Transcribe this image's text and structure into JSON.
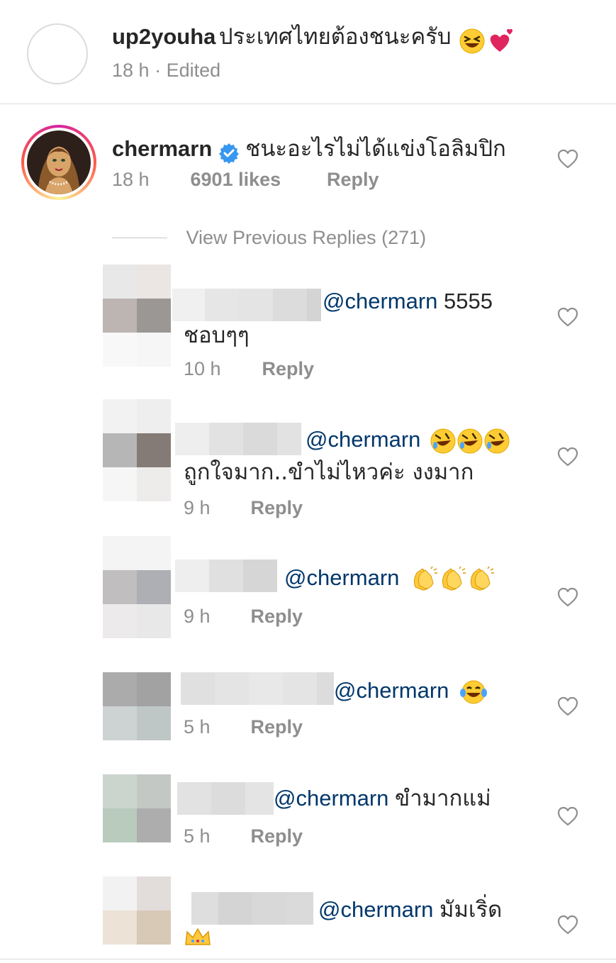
{
  "top_comment": {
    "username": "up2youha",
    "text": "ประเทศไทยต้องชนะครับ",
    "time": "18 h",
    "separator": "·",
    "edited": "Edited",
    "emojis": [
      "laughing-emoji",
      "two-hearts-emoji"
    ]
  },
  "main_comment": {
    "username": "chermarn",
    "verified": true,
    "text": "ชนะอะไรไม่ได้แข่งโอลิมปิก",
    "time": "18 h",
    "likes": "6901 likes",
    "reply_label": "Reply"
  },
  "view_previous": "View Previous Replies (271)",
  "replies": [
    {
      "mention": "@chermarn",
      "text_after": "5555",
      "line2": "ชอบๆๆ",
      "time": "10 h",
      "reply_label": "Reply",
      "emojis": []
    },
    {
      "mention": "@chermarn",
      "text_after": "",
      "line2": "ถูกใจมาก..ขำไม่ไหวค่ะ งงมาก",
      "time": "9 h",
      "reply_label": "Reply",
      "emojis": [
        "rofl-emoji",
        "rofl-emoji",
        "rofl-emoji"
      ]
    },
    {
      "mention": "@chermarn",
      "text_after": "",
      "line2": "",
      "time": "9 h",
      "reply_label": "Reply",
      "emojis": [
        "clapping-hands-emoji",
        "clapping-hands-emoji",
        "clapping-hands-emoji"
      ]
    },
    {
      "mention": "@chermarn",
      "text_after": "",
      "line2": "",
      "time": "5 h",
      "reply_label": "Reply",
      "emojis": [
        "tears-of-joy-emoji"
      ]
    },
    {
      "mention": "@chermarn",
      "text_after": "ขำมากแม่",
      "line2": "",
      "time": "5 h",
      "reply_label": "Reply",
      "emojis": []
    },
    {
      "mention": "@chermarn",
      "text_after": "มัมเริ่ด",
      "line2": "",
      "time": "",
      "reply_label": "",
      "emojis": [
        "crown-emoji"
      ]
    }
  ],
  "colors": {
    "text": "#262626",
    "secondary": "#8e8e8e",
    "mention": "#00376b",
    "verified": "#3897f0",
    "divider": "#dbdbdb"
  }
}
